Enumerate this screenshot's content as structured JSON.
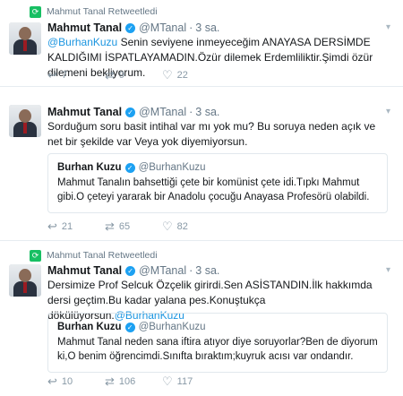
{
  "retweet_label": "Mahmut Tanal Retweetledi",
  "author": {
    "name": "Mahmut Tanal",
    "handle": "@MTanal",
    "time": "3 sa."
  },
  "quote_author": {
    "name": "Burhan Kuzu",
    "handle": "@BurhanKuzu"
  },
  "tweets": [
    {
      "mention": "@BurhanKuzu",
      "text_a": " Senin seviyene inmeyeceğim ANAYASA DERSİMDE KALDIĞIMI İSPATLAYAMADIN.Özür dilemek Erdemliliktir.Şimdi özür dilemeni bekliyorum.",
      "reply": "7",
      "retweet": "9",
      "like": "22"
    },
    {
      "text": "Sorduğum soru basit intihal var mı yok mu? Bu soruya neden açık ve net bir şekilde var Veya yok diyemiyorsun.",
      "quote": "Mahmut Tanalın bahsettiği çete bir komünist çete idi.Tıpkı Mahmut gibi.O çeteyi yararak bir Anadolu çocuğu Anayasa Profesörü olabildi.",
      "reply": "21",
      "retweet": "65",
      "like": "82"
    },
    {
      "text_a": "Dersimize Prof Selcuk Özçelik girirdi.Sen ASİSTANDIN.İlk hakkımda dersi geçtim.Bu kadar yalana pes.Konuştukça dökülüyorsun.",
      "mention": "@BurhanKuzu",
      "quote": "Mahmut Tanal neden sana iftira atıyor diye soruyorlar?Ben de diyorum ki,O benim öğrencimdi.Sınıfta bıraktım;kuyruk acısı var ondandır.",
      "reply": "10",
      "retweet": "106",
      "like": "117"
    }
  ],
  "icons": {
    "reply": "reply-icon",
    "retweet": "retweet-icon",
    "like": "heart-icon",
    "more": "chevron-down-icon",
    "verified": "verified-badge-icon"
  },
  "colors": {
    "link": "#1b95e0",
    "verified": "#1da1f2",
    "retweet_green": "#17bf63"
  }
}
